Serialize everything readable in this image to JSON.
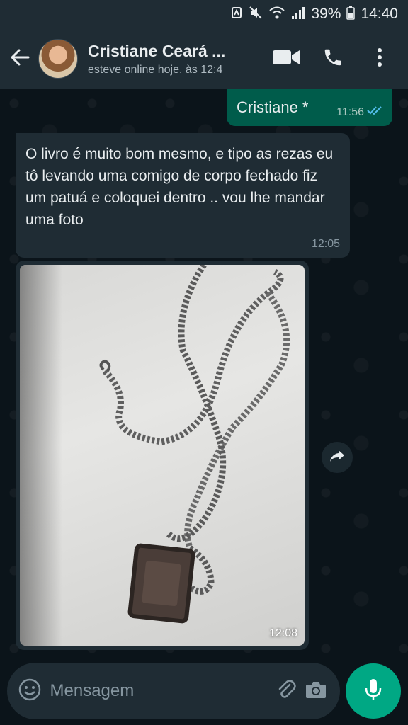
{
  "status_bar": {
    "battery": "39%",
    "time": "14:40",
    "icons": [
      "nfc-icon",
      "mute-icon",
      "wifi-icon",
      "signal-icon",
      "battery-icon"
    ]
  },
  "header": {
    "contact_name": "Cristiane Ceará ...",
    "last_seen": "esteve online hoje, às 12:4",
    "icons": [
      "back-arrow-icon",
      "video-call-icon",
      "phone-icon",
      "more-vert-icon"
    ]
  },
  "messages": [
    {
      "direction": "out",
      "text": "Cristiane *",
      "time": "11:56",
      "status": "read"
    },
    {
      "direction": "in",
      "text": "O livro é muito bom mesmo, e tipo as rezas eu tô levando uma comigo de corpo fechado fiz um patuá e coloquei dentro .. vou lhe mandar uma foto",
      "time": "12:05"
    },
    {
      "direction": "in",
      "type": "image",
      "time": "12:08"
    }
  ],
  "composer": {
    "placeholder": "Mensagem",
    "icons": [
      "emoji-icon",
      "attach-icon",
      "camera-icon",
      "mic-icon"
    ]
  },
  "colors": {
    "background": "#0b141a",
    "header": "#1f2c34",
    "outgoing_bubble": "#005c4b",
    "incoming_bubble": "#1f2c34",
    "accent": "#00a884",
    "read_ticks": "#53bdeb"
  }
}
